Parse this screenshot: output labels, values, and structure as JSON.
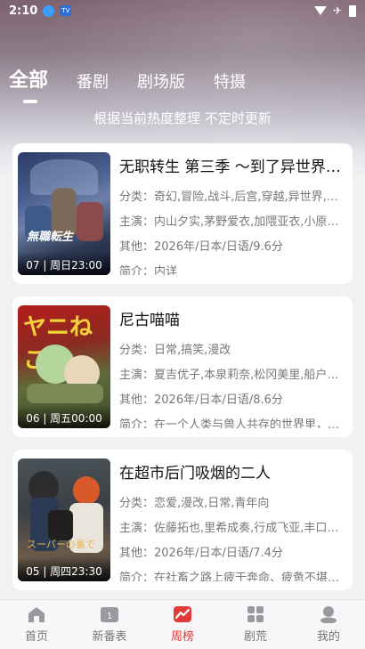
{
  "status_bar": {
    "time": "2:10",
    "tv_icon_text": "TV"
  },
  "tabs": [
    {
      "label": "全部",
      "active": true
    },
    {
      "label": "番剧",
      "active": false
    },
    {
      "label": "剧场版",
      "active": false
    },
    {
      "label": "特摄",
      "active": false
    }
  ],
  "subtitle": "根据当前热度整理 不定时更新",
  "items": [
    {
      "title": "无职转生 第三季 ～到了异世界就拿出真本事～",
      "poster_label": "07 | 周日23:00",
      "genres": "分类：奇幻,冒险,战斗,后宫,穿越,异世界,轻改",
      "cast": "主演：内山夕实,茅野爱衣,加隈亚衣,小原好美",
      "other": "其他：2026年/日本/日语/9.6分",
      "summary": "简介：内详"
    },
    {
      "title": "尼古喵喵",
      "poster_label": "06 | 周五00:00",
      "genres": "分类：日常,搞笑,漫改",
      "cast": "主演：夏吉优子,本泉莉奈,松冈美里,船户ゆり絵",
      "other": "其他：2026年/日本/日语/8.6分",
      "summary": "简介：在一个人类与兽人共存的世界里，不良少女"
    },
    {
      "title": "在超市后门吸烟的二人",
      "poster_label": "05 | 周四23:30",
      "genres": "分类：恋爱,漫改,日常,青年向",
      "cast": "主演：佐藤拓也,里希成奏,行成飞亚,丰口めぐみ",
      "other": "其他：2026年/日本/日语/7.4分",
      "summary": "简介：在社畜之路上疲于奔命、疲惫不堪的中年"
    }
  ],
  "bottom_nav": [
    {
      "label": "首页",
      "icon": "home-icon",
      "active": false
    },
    {
      "label": "新番表",
      "icon": "calendar-icon",
      "active": false
    },
    {
      "label": "周榜",
      "icon": "trend-icon",
      "active": true
    },
    {
      "label": "剧荒",
      "icon": "grid-icon",
      "active": false
    },
    {
      "label": "我的",
      "icon": "profile-icon",
      "active": false
    }
  ],
  "colors": {
    "accent": "#e33a3a",
    "nav_inactive": "#777777"
  }
}
